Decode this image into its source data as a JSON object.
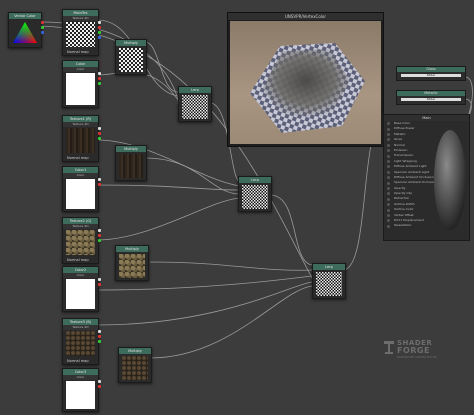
{
  "colors": {
    "node_header": "#3d6b5c",
    "canvas": "#3c3c3c",
    "wire": "#9a9a9a"
  },
  "vector_node": {
    "title": "Vector Color"
  },
  "main_tex_node": {
    "title": "MainTex",
    "sub": "Texture 2D",
    "normal_label": "Normal map"
  },
  "color_node_1": {
    "title": "Color",
    "sub": "Color"
  },
  "texture_r": {
    "title": "Texture1 (R)",
    "sub": "Texture 2D",
    "normal_label": "Normal map"
  },
  "color_r": {
    "title": "Color1",
    "sub": "Color"
  },
  "texture_g": {
    "title": "Texture2 (G)",
    "sub": "Texture 2D",
    "normal_label": "Normal map"
  },
  "color_g": {
    "title": "Color2",
    "sub": "Color"
  },
  "texture_b": {
    "title": "Texture3 (B)",
    "sub": "Texture 2D",
    "normal_label": "Normal map"
  },
  "color_b": {
    "title": "Color3",
    "sub": "Color"
  },
  "multiply_nodes": [
    "Multiply",
    "Multiply",
    "Multiply",
    "Multiply"
  ],
  "lerp_nodes": [
    "Lerp",
    "Lerp",
    "Lerp"
  ],
  "preview": {
    "title": "UNSVPR/VertexColor"
  },
  "gloss": {
    "title": "Gloss",
    "value": "Slider"
  },
  "metallic": {
    "title": "Metallic",
    "value": "Slider"
  },
  "main_node": {
    "title": "Main",
    "inputs": [
      "Base Color",
      "Diffuse Power",
      "Metallic",
      "Gloss",
      "Normal",
      "Emission",
      "Transmission",
      "Light Wrapping",
      "Diffuse Ambient Light",
      "Specular Ambient Light",
      "Diffuse Ambient Occlusion",
      "Specular Ambient Occlusion",
      "Opacity",
      "Opacity Clip",
      "Refraction",
      "Outline Width",
      "Outline Color",
      "Vertex Offset",
      "DX11 Displacement",
      "Tessellation"
    ]
  },
  "logo": {
    "line1": "SHADER",
    "line2": "FORGE",
    "tagline": "NODE-BASED SHADER EDITOR"
  }
}
